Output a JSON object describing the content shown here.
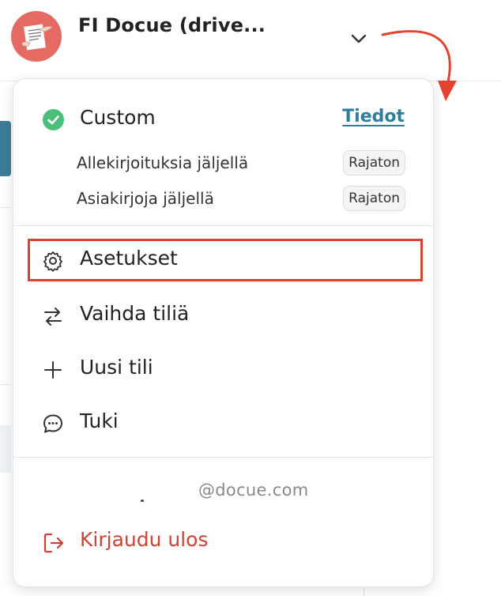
{
  "header": {
    "account_name": "FI Docue (drive..."
  },
  "plan": {
    "name": "Custom",
    "details_link": "Tiedot",
    "quotas": [
      {
        "label": "Allekirjoituksia jäljellä",
        "value": "Rajaton"
      },
      {
        "label": "Asiakirjoja jäljellä",
        "value": "Rajaton"
      }
    ]
  },
  "menu": {
    "items": [
      {
        "label": "Asetukset",
        "icon": "gear-icon"
      },
      {
        "label": "Vaihda tiliä",
        "icon": "swap-arrows-icon"
      },
      {
        "label": "Uusi tili",
        "icon": "plus-icon"
      },
      {
        "label": "Tuki",
        "icon": "chat-bubble-icon"
      }
    ],
    "email": "@docue.com",
    "logout_label": "Kirjaudu ulos"
  },
  "colors": {
    "accent": "#2f7e9c",
    "success": "#4bbf7a",
    "danger": "#d44035",
    "highlight_border": "#d94432"
  }
}
